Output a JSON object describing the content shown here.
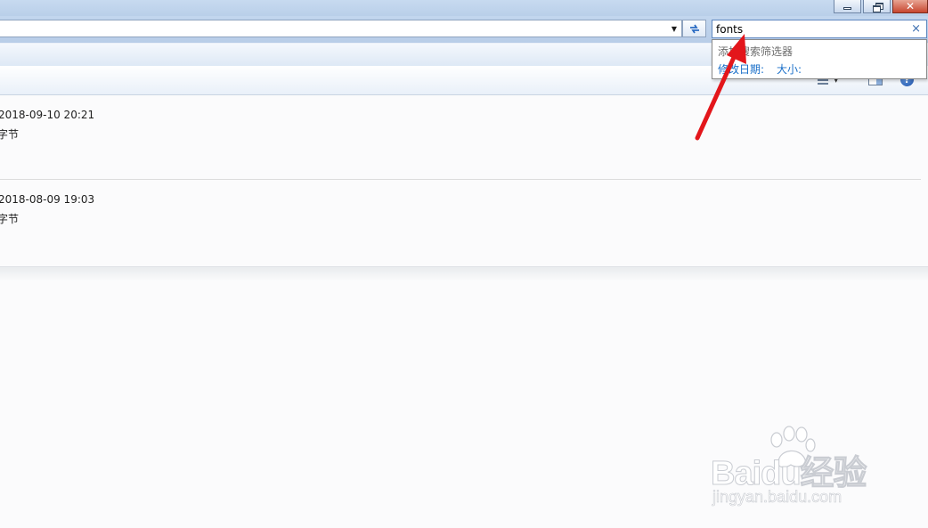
{
  "window": {
    "close_glyph": "✕"
  },
  "address_bar": {
    "path": "",
    "dropdown_icon": "chevron-down-icon",
    "refresh_icon": "refresh-icon"
  },
  "search": {
    "value": "fonts",
    "clear_glyph": "×"
  },
  "search_filter_popup": {
    "header": "添加搜索筛选器",
    "filters": [
      {
        "label": "修改日期:"
      },
      {
        "label": "大小:"
      }
    ]
  },
  "toolbar": {
    "views_icon": "views-icon",
    "preview_icon": "preview-pane-icon",
    "help_glyph": "?"
  },
  "results": [
    {
      "date": "2018-09-10 20:21",
      "size": "字节"
    },
    {
      "date": "2018-08-09 19:03",
      "size": "字节"
    }
  ],
  "watermark": {
    "brand": "Baidu经验",
    "url": "jingyan.baidu.com"
  },
  "colors": {
    "title_bar": "#c7daf0",
    "search_border": "#5f88c0",
    "filter_link": "#1a6fc9",
    "annotation_arrow": "#e3161b",
    "close_button": "#c7462f"
  }
}
